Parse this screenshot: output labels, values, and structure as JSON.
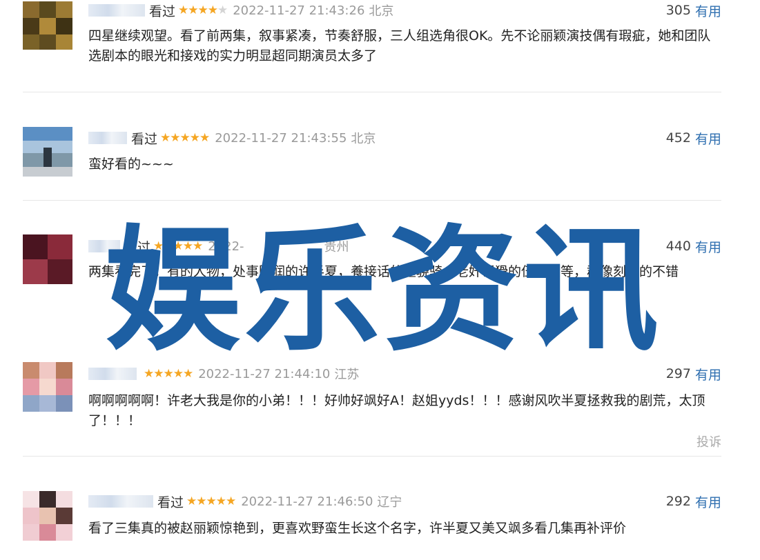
{
  "comments": [
    {
      "watched": "看过",
      "stars": "★★★★",
      "stars_off": "★",
      "time": "2022-11-27 21:43:26",
      "location": "北京",
      "votes": "305",
      "useful": "有用",
      "content": "四星继续观望。看了前两集，叙事紧凑，节奏舒服，三人组选角很OK。先不论丽颖演技偶有瑕疵，她和团队选剧本的眼光和接戏的实力明显超同期演员太多了"
    },
    {
      "watched": "看过",
      "stars": "★★★★★",
      "stars_off": "",
      "time": "2022-11-27 21:43:55",
      "location": "北京",
      "votes": "452",
      "useful": "有用",
      "content": "蛮好看的~~~"
    },
    {
      "watched": "看过",
      "stars": "★★★★★",
      "stars_off": "",
      "time": "2022-",
      "location": "贵州",
      "votes": "440",
      "useful": "有用",
      "content": "两集看完了，有的人物，处事圆润的许半夏，養接话的童骁骑，老奸巨猾的伍建设等，群像刻画的不错"
    },
    {
      "watched": "",
      "stars": "★★★★★",
      "stars_off": "",
      "time": "2022-11-27 21:44:10",
      "location": "江苏",
      "votes": "297",
      "useful": "有用",
      "content": "啊啊啊啊啊！许老大我是你的小弟！！！好帅好飒好A！赵姐yyds！！！感谢风吹半夏拯救我的剧荒，太顶了！！！",
      "report": "投诉"
    },
    {
      "watched": "看过",
      "stars": "★★★★★",
      "stars_off": "",
      "time": "2022-11-27 21:46:50",
      "location": "辽宁",
      "votes": "292",
      "useful": "有用",
      "content": "看了三集真的被赵丽颖惊艳到，更喜欢野蛮生长这个名字，许半夏又美又飒多看几集再补评价"
    }
  ],
  "watermark": "娱乐资讯",
  "colors": {
    "star": "#f5a623",
    "useful_link": "#2f6fb0",
    "watermark": "#1d5fa3",
    "meta_gray": "#9a9a9a"
  }
}
